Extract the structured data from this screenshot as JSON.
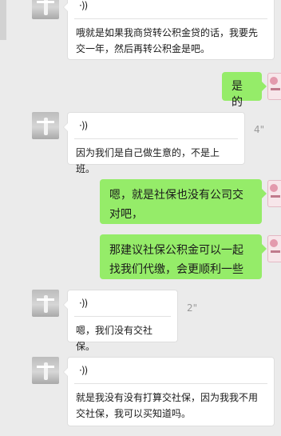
{
  "messages": [
    {
      "side": "left",
      "type": "voice",
      "voice_icon": "·))",
      "duration": "",
      "transcript": "哦就是如果我商贷转公积金贷的话，我要先交一年，然后再转公积金是吧。"
    },
    {
      "side": "right",
      "type": "text",
      "text": "是的"
    },
    {
      "side": "left",
      "type": "voice",
      "voice_icon": "·))",
      "duration": "4\"",
      "transcript": "因为我们是自己做生意的，不是上班。"
    },
    {
      "side": "right",
      "type": "text",
      "text": "嗯，就是社保也没有公司交对吧，"
    },
    {
      "side": "right",
      "type": "text",
      "text": "那建议社保公积金可以一起找我们代缴，会更顺利一些"
    },
    {
      "side": "left",
      "type": "voice",
      "voice_icon": "·))",
      "duration": "2\"",
      "transcript": "嗯，我们没有交社保。"
    },
    {
      "side": "left",
      "type": "voice",
      "voice_icon": "·))",
      "duration": "",
      "transcript": "就是我没有没有打算交社保，因为我我不用交社保，我可以买知道吗。"
    }
  ],
  "colors": {
    "background": "#ebebeb",
    "outgoing_bubble": "#95ec69",
    "incoming_bubble": "#ffffff",
    "duration_text": "#9a9a9a"
  }
}
